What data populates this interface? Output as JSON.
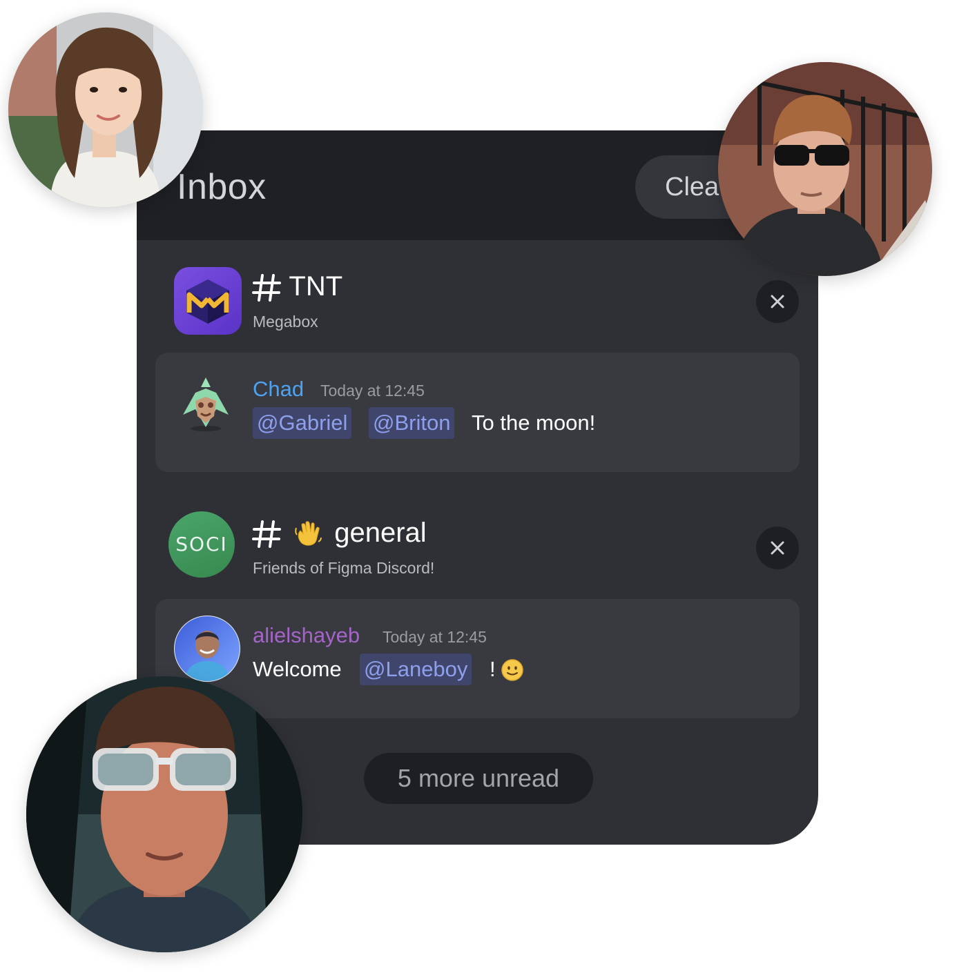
{
  "header": {
    "title": "Inbox",
    "clear_label": "Clea"
  },
  "notifications": [
    {
      "channel": "TNT",
      "server": "Megabox",
      "message": {
        "author": "Chad",
        "timestamp": "Today at 12:45",
        "mentions": [
          "@Gabriel",
          "@Briton"
        ],
        "text": "To the moon!"
      }
    },
    {
      "channel": "general",
      "channel_emoji": "waving-hand-icon",
      "server": "Friends of Figma Discord!",
      "server_badge": "SOCI",
      "message": {
        "author": "alielshayeb",
        "timestamp": "Today at 12:45",
        "text_before": "Welcome",
        "mentions": [
          "@Laneboy"
        ],
        "text_after": "!",
        "emoji": "slightly-smiling-face-icon"
      }
    }
  ],
  "footer": {
    "more_unread": "5 more unread"
  },
  "colors": {
    "panel_bg": "#2f3035",
    "header_bg": "#1f2024",
    "card_bg": "#383a40",
    "mention_bg": "#40456b",
    "mention_text": "#8ea0ec",
    "author_chad": "#4ea2f2",
    "author_alielshayeb": "#a564c7",
    "soci_green": "#41a063",
    "megabox_purple": "#6c43d8"
  }
}
